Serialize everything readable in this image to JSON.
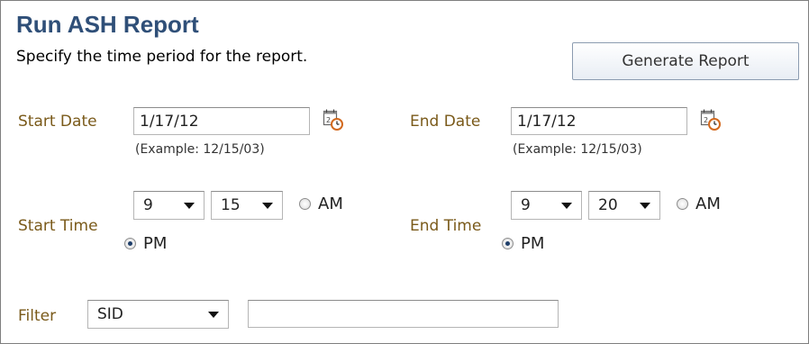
{
  "header": {
    "title": "Run ASH Report",
    "subtitle": "Specify the time period for the report."
  },
  "toolbar": {
    "generate_label": "Generate Report"
  },
  "start_date": {
    "label": "Start Date",
    "value": "1/17/12",
    "example": "(Example: 12/15/03)"
  },
  "end_date": {
    "label": "End Date",
    "value": "1/17/12",
    "example": "(Example: 12/15/03)"
  },
  "start_time": {
    "label": "Start Time",
    "hour": "9",
    "minute": "15",
    "am_label": "AM",
    "pm_label": "PM",
    "selected": "PM"
  },
  "end_time": {
    "label": "End Time",
    "hour": "9",
    "minute": "20",
    "am_label": "AM",
    "pm_label": "PM",
    "selected": "PM"
  },
  "filter": {
    "label": "Filter",
    "selected": "SID",
    "value": ""
  },
  "icons": {
    "calendar": "calendar-clock-icon",
    "dropdown": "chevron-down-icon"
  }
}
